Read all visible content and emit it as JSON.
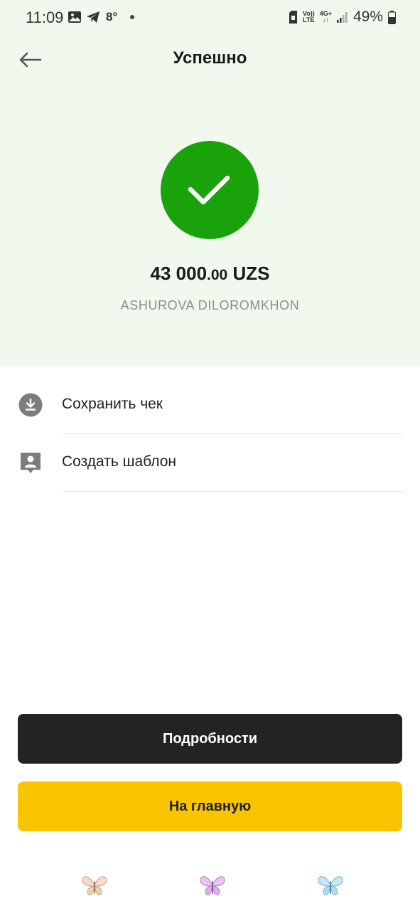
{
  "status_bar": {
    "time": "11:09",
    "temperature": "8°",
    "volte_line1": "Vo))",
    "volte_line2": "LTE",
    "network": "4G+",
    "battery": "49%"
  },
  "header": {
    "title": "Успешно",
    "back_icon": "arrow-left-icon"
  },
  "transaction": {
    "status_icon": "checkmark-icon",
    "amount_main": "43 000",
    "amount_decimal": ".00",
    "currency": "UZS",
    "recipient": "ASHUROVA DILOROMKHON"
  },
  "actions": [
    {
      "label": "Сохранить чек",
      "icon": "download-icon"
    },
    {
      "label": "Создать шаблон",
      "icon": "template-contact-icon"
    }
  ],
  "buttons": {
    "details": "Подробности",
    "home": "На главную"
  },
  "nav_bar": {
    "items": [
      "butterfly-peach-icon",
      "butterfly-purple-icon",
      "butterfly-blue-icon"
    ]
  },
  "colors": {
    "success_green": "#1aa20a",
    "header_bg": "#f1f8ee",
    "primary_dark": "#232323",
    "accent_yellow": "#f9c400",
    "muted_text": "#8d8d8d"
  }
}
